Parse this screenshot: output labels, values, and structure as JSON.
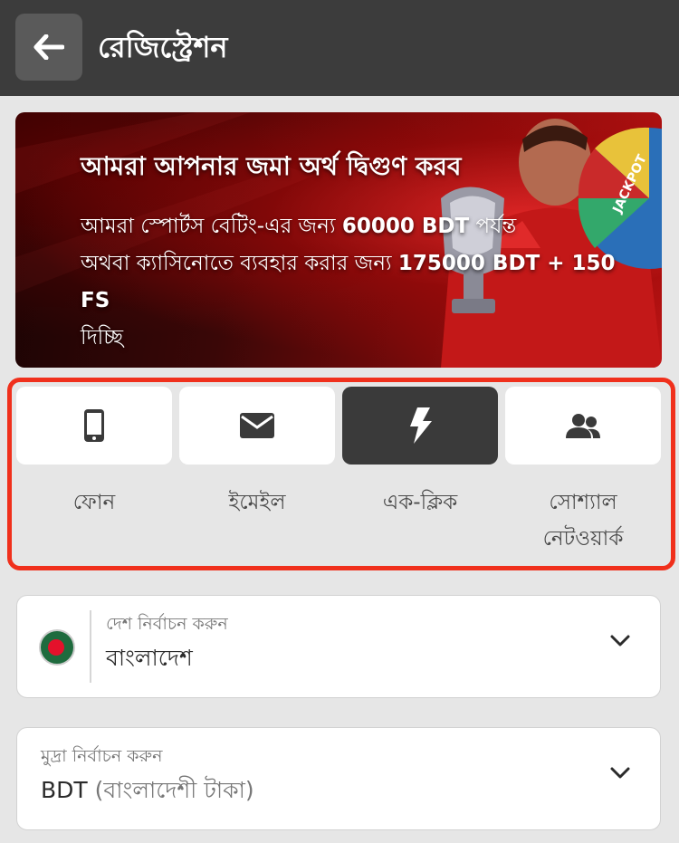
{
  "header": {
    "title": "রেজিস্ট্রেশন"
  },
  "banner": {
    "title": "আমরা আপনার জমা অর্থ দ্বিগুণ করব",
    "line1_prefix": "আমরা স্পোর্টস বেটিং-এর জন্য ",
    "line1_amount": "60000 BDT",
    "line1_suffix": " পর্যন্ত",
    "line2_prefix": "অথবা ক্যাসিনোতে ব্যবহার করার জন্য ",
    "line2_amount": "175000 BDT + 150 FS",
    "line3": "দিচ্ছি",
    "wheel_text": "JACKPOT"
  },
  "methods": [
    {
      "label": "ফোন",
      "icon": "phone-icon",
      "active": false
    },
    {
      "label": "ইমেইল",
      "icon": "mail-icon",
      "active": false
    },
    {
      "label": "এক-ক্লিক",
      "icon": "lightning-icon",
      "active": true
    },
    {
      "label_line1": "সোশ্যাল",
      "label_line2": "নেটওয়ার্ক",
      "icon": "users-icon",
      "active": false
    }
  ],
  "country_select": {
    "caption": "দেশ নির্বাচন করুন",
    "value": "বাংলাদেশ"
  },
  "currency_select": {
    "caption": "মুদ্রা নির্বাচন করুন",
    "code": "BDT",
    "name": "(বাংলাদেশী টাকা)"
  },
  "colors": {
    "header_bg": "#3c3c3c",
    "highlight_border": "#f0301c",
    "active_method_bg": "#3a3a3a",
    "page_bg": "#e6e6e6"
  }
}
